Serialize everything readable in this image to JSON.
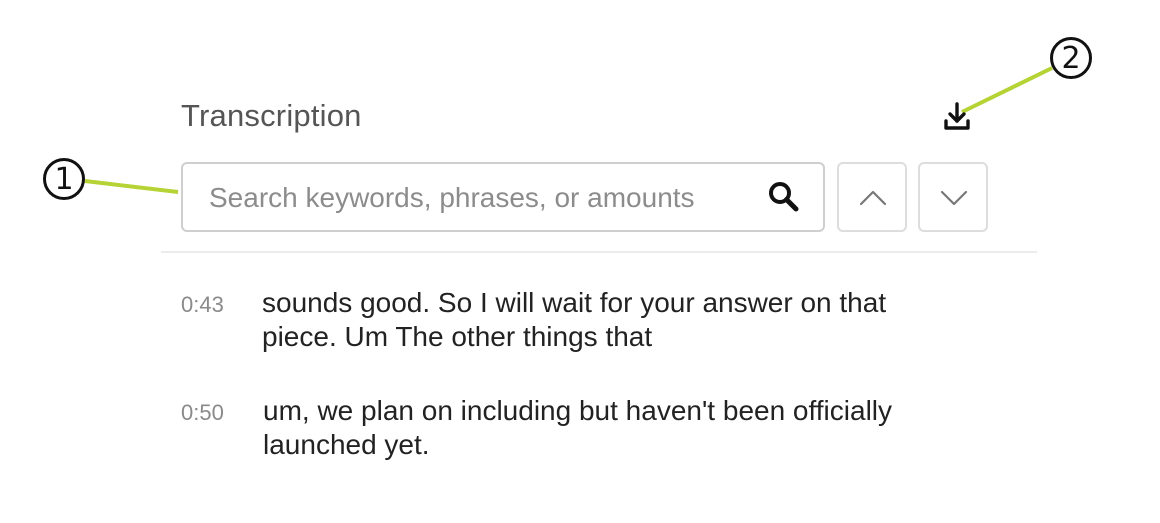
{
  "panel": {
    "title": "Transcription",
    "download_icon": "download-icon"
  },
  "search": {
    "placeholder": "Search keywords, phrases, or amounts",
    "value": "",
    "icon": "search-icon"
  },
  "navigation": {
    "prev_icon": "chevron-up-icon",
    "next_icon": "chevron-down-icon"
  },
  "transcript": [
    {
      "time": "0:43",
      "text_line_1": "sounds good. So I will wait for your answer on that",
      "text_line_2": "piece. Um The other things that"
    },
    {
      "time": "0:50",
      "text_line_1": "um, we plan on including but haven't been officially",
      "text_line_2": "launched yet."
    }
  ],
  "callouts": [
    {
      "number": "1"
    },
    {
      "number": "2"
    }
  ],
  "colors": {
    "callout_line": "#b5d334",
    "border": "#cfcfcf",
    "timestamp": "#8a8a8a",
    "title": "#555555"
  }
}
